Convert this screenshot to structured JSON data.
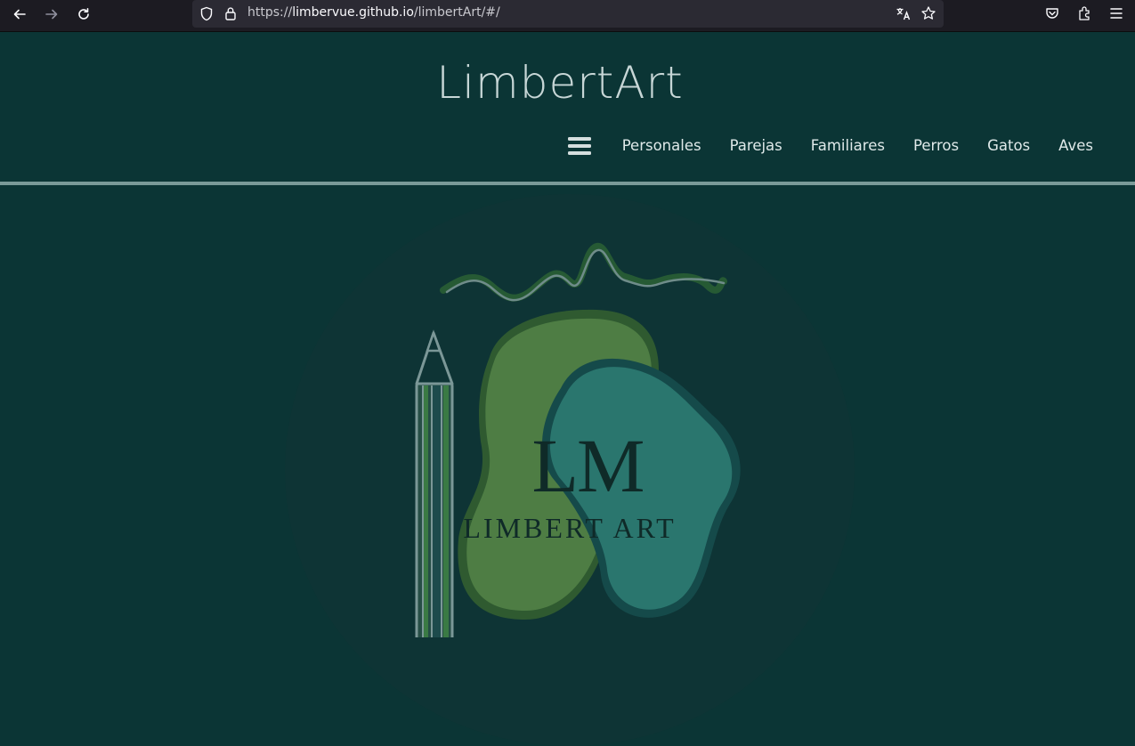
{
  "browser": {
    "url_scheme": "https://",
    "url_host": "limbervue.github.io",
    "url_path": "/limbertArt/#/"
  },
  "site": {
    "title": "LimbertArt",
    "nav": [
      {
        "label": "Personales"
      },
      {
        "label": "Parejas"
      },
      {
        "label": "Familiares"
      },
      {
        "label": "Perros"
      },
      {
        "label": "Gatos"
      },
      {
        "label": "Aves"
      }
    ]
  },
  "logo": {
    "monogram": "LM",
    "wordmark": "LIMBERT ART"
  },
  "colors": {
    "background": "#0b3535",
    "divider": "#7a9a98",
    "logo_green": "#4e7d44",
    "logo_teal": "#2a766e"
  }
}
